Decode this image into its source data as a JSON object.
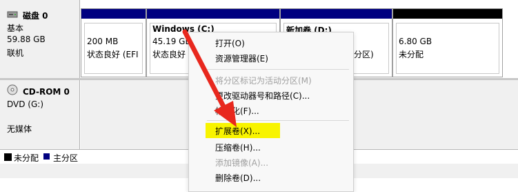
{
  "disk0": {
    "name": "磁盘 0",
    "type": "基本",
    "size": "59.88 GB",
    "status": "联机",
    "partitions": [
      {
        "size": "200 MB",
        "status": "状态良好 (EFI"
      },
      {
        "name": "Windows  (C:)",
        "size": "45.19 GB",
        "status": "状态良好"
      },
      {
        "name": "新加卷  (D:)",
        "status_tail": "分区)"
      },
      {
        "size": "6.80 GB",
        "status": "未分配"
      }
    ]
  },
  "cdrom0": {
    "name": "CD-ROM 0",
    "drive": "DVD (G:)",
    "media": "无媒体"
  },
  "legend": {
    "unallocated": "未分配",
    "primary": "主分区"
  },
  "context_menu": {
    "items": [
      {
        "label": "打开(O)",
        "enabled": true
      },
      {
        "label": "资源管理器(E)",
        "enabled": true
      },
      {
        "label": "将分区标记为活动分区(M)",
        "enabled": false
      },
      {
        "label": "更改驱动器号和路径(C)...",
        "enabled": true
      },
      {
        "label": "格式化(F)...",
        "enabled": true
      },
      {
        "label": "扩展卷(X)...",
        "enabled": true,
        "highlighted": true
      },
      {
        "label": "压缩卷(H)...",
        "enabled": true
      },
      {
        "label": "添加镜像(A)...",
        "enabled": false
      },
      {
        "label": "删除卷(D)...",
        "enabled": true
      }
    ]
  },
  "colors": {
    "primary_bar": "#000080",
    "unallocated_bar": "#000000",
    "highlight": "#f8f400",
    "arrow": "#e8281e"
  },
  "icons": {
    "disk": "disk-icon",
    "cdrom": "cdrom-icon"
  }
}
